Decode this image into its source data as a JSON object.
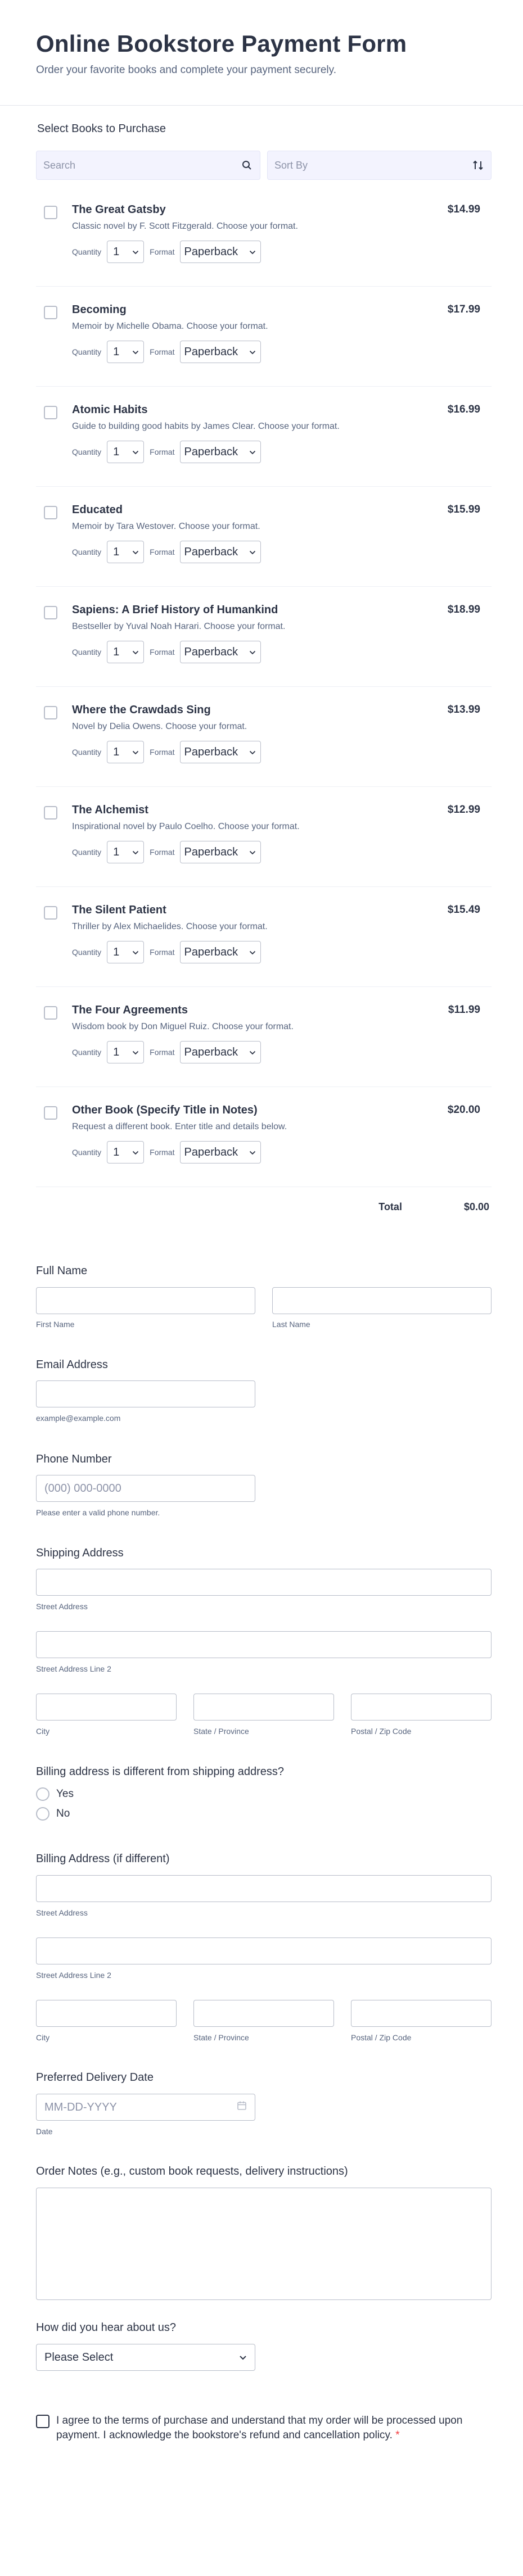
{
  "form": {
    "title": "Online Bookstore Payment Form",
    "subtitle": "Order your favorite books and complete your payment securely."
  },
  "products": {
    "label": "Select Books to Purchase",
    "search_placeholder": "Search",
    "sort_placeholder": "Sort By",
    "quantity_label": "Quantity",
    "format_label": "Format",
    "items": [
      {
        "title": "The Great Gatsby",
        "desc": "Classic novel by F. Scott Fitzgerald. Choose your format.",
        "price": "$14.99",
        "qty": "1",
        "format": "Paperback"
      },
      {
        "title": "Becoming",
        "desc": "Memoir by Michelle Obama. Choose your format.",
        "price": "$17.99",
        "qty": "1",
        "format": "Paperback"
      },
      {
        "title": "Atomic Habits",
        "desc": "Guide to building good habits by James Clear. Choose your format.",
        "price": "$16.99",
        "qty": "1",
        "format": "Paperback"
      },
      {
        "title": "Educated",
        "desc": "Memoir by Tara Westover. Choose your format.",
        "price": "$15.99",
        "qty": "1",
        "format": "Paperback"
      },
      {
        "title": "Sapiens: A Brief History of Humankind",
        "desc": "Bestseller by Yuval Noah Harari. Choose your format.",
        "price": "$18.99",
        "qty": "1",
        "format": "Paperback"
      },
      {
        "title": "Where the Crawdads Sing",
        "desc": "Novel by Delia Owens. Choose your format.",
        "price": "$13.99",
        "qty": "1",
        "format": "Paperback"
      },
      {
        "title": "The Alchemist",
        "desc": "Inspirational novel by Paulo Coelho. Choose your format.",
        "price": "$12.99",
        "qty": "1",
        "format": "Paperback"
      },
      {
        "title": "The Silent Patient",
        "desc": "Thriller by Alex Michaelides. Choose your format.",
        "price": "$15.49",
        "qty": "1",
        "format": "Paperback"
      },
      {
        "title": "The Four Agreements",
        "desc": "Wisdom book by Don Miguel Ruiz. Choose your format.",
        "price": "$11.99",
        "qty": "1",
        "format": "Paperback"
      },
      {
        "title": "Other Book (Specify Title in Notes)",
        "desc": "Request a different book. Enter title and details below.",
        "price": "$20.00",
        "qty": "1",
        "format": "Paperback"
      }
    ],
    "total_label": "Total",
    "total_value": "$0.00"
  },
  "full_name": {
    "label": "Full Name",
    "first_hint": "First Name",
    "last_hint": "Last Name"
  },
  "email": {
    "label": "Email Address",
    "hint": "example@example.com"
  },
  "phone": {
    "label": "Phone Number",
    "placeholder": "(000) 000-0000",
    "hint": "Please enter a valid phone number."
  },
  "shipping": {
    "label": "Shipping Address",
    "street": "Street Address",
    "street2": "Street Address Line 2",
    "city": "City",
    "state": "State / Province",
    "zip": "Postal / Zip Code"
  },
  "billing_question": {
    "label": "Billing address is different from shipping address?",
    "yes": "Yes",
    "no": "No"
  },
  "billing": {
    "label": "Billing Address (if different)",
    "street": "Street Address",
    "street2": "Street Address Line 2",
    "city": "City",
    "state": "State / Province",
    "zip": "Postal / Zip Code"
  },
  "delivery": {
    "label": "Preferred Delivery Date",
    "placeholder": "MM-DD-YYYY",
    "hint": "Date"
  },
  "notes": {
    "label": "Order Notes (e.g., custom book requests, delivery instructions)"
  },
  "referral": {
    "label": "How did you hear about us?",
    "selected": "Please Select"
  },
  "terms": {
    "text": "I agree to the terms of purchase and understand that my order will be processed upon payment. I acknowledge the bookstore's refund and cancellation policy.",
    "required_mark": "*"
  }
}
